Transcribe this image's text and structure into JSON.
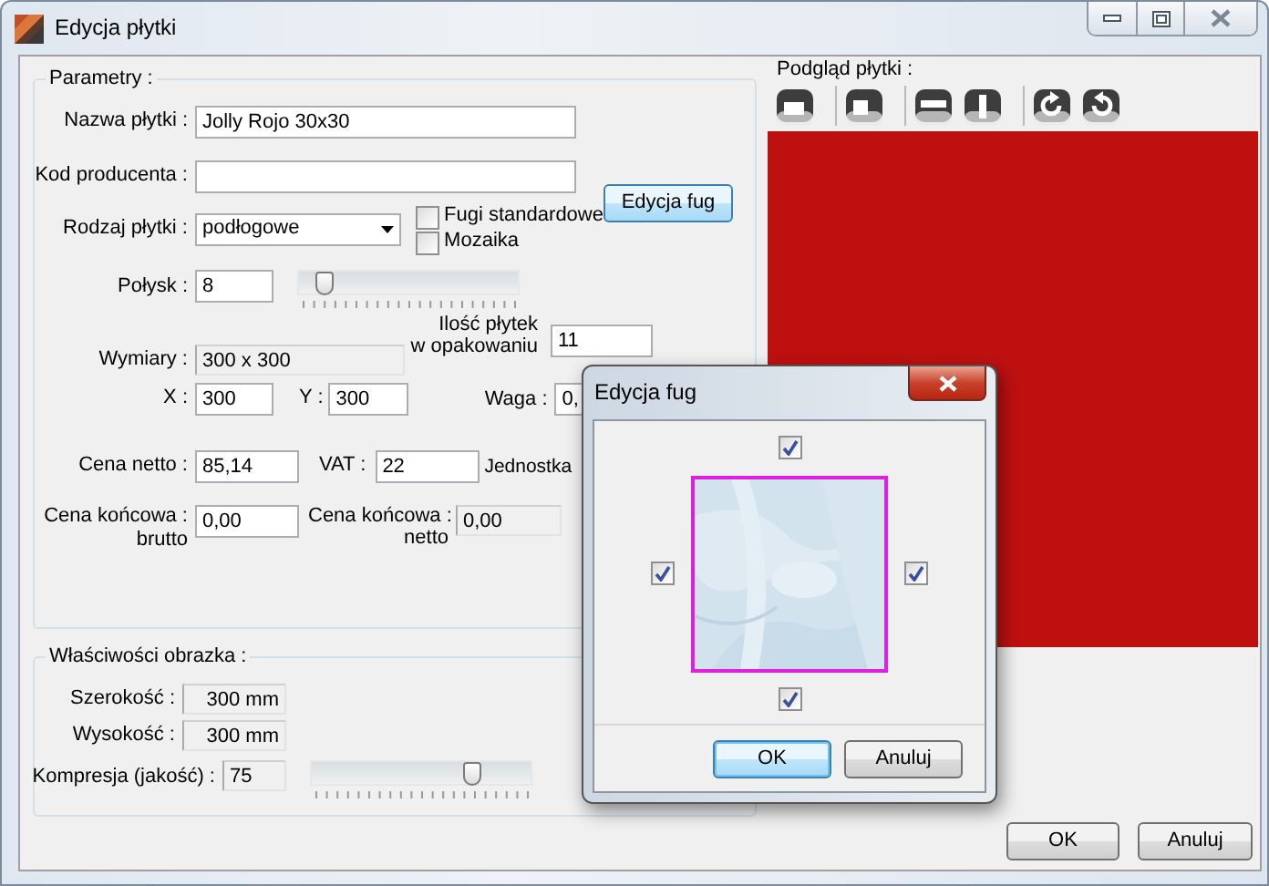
{
  "window": {
    "title": "Edycja płytki"
  },
  "parameters": {
    "title": "Parametry :",
    "name": {
      "label": "Nazwa płytki :",
      "value": "Jolly Rojo 30x30"
    },
    "producer_code": {
      "label": "Kod producenta :"
    },
    "tile_type": {
      "label": "Rodzaj płytki :",
      "value": "podłogowe"
    },
    "checkboxes": [
      {
        "label": "Fugi standardowe",
        "checked": false
      },
      {
        "label": "Mozaika",
        "checked": false
      }
    ],
    "joints_button": "Edycja fug",
    "gloss": {
      "label": "Połysk :",
      "value": "8",
      "level": 0.08
    },
    "pack_count": {
      "label": "Ilość płytek\nw opakowaniu",
      "value": "11"
    },
    "dimensions": {
      "label": "Wymiary :",
      "value": "300 x 300"
    },
    "x": {
      "label": "X :",
      "value": "300"
    },
    "y": {
      "label": "Y :",
      "value": "300"
    },
    "weight": {
      "label": "Waga :",
      "value": "0,"
    },
    "net_price": {
      "label": "Cena netto :",
      "value": "85,14"
    },
    "vat": {
      "label": "VAT :",
      "value": "22"
    },
    "unit": {
      "label": "Jednostka"
    },
    "final_gross": {
      "label": "Cena końcowa :\nbrutto",
      "value": "0,00"
    },
    "final_net": {
      "label": "Cena końcowa :\nnetto",
      "value": "0,00"
    }
  },
  "image_properties": {
    "title": "Właściwości obrazka :",
    "width": {
      "label": "Szerokość :",
      "value": "300 mm"
    },
    "height": {
      "label": "Wysokość :",
      "value": "300 mm"
    },
    "compression": {
      "label": "Kompresja (jakość) :",
      "value": "75",
      "level": 0.75
    }
  },
  "preview": {
    "title": "Podgląd płytki :"
  },
  "buttons": [
    {
      "label": "OK"
    },
    {
      "label": "Anuluj"
    }
  ],
  "joints_dialog": {
    "title": "Edycja fug",
    "edges": [
      {
        "checked": true
      },
      {
        "checked": true
      },
      {
        "checked": true
      },
      {
        "checked": true
      }
    ],
    "buttons": [
      {
        "label": "OK",
        "default": true
      },
      {
        "label": "Anuluj",
        "default": false
      }
    ]
  }
}
